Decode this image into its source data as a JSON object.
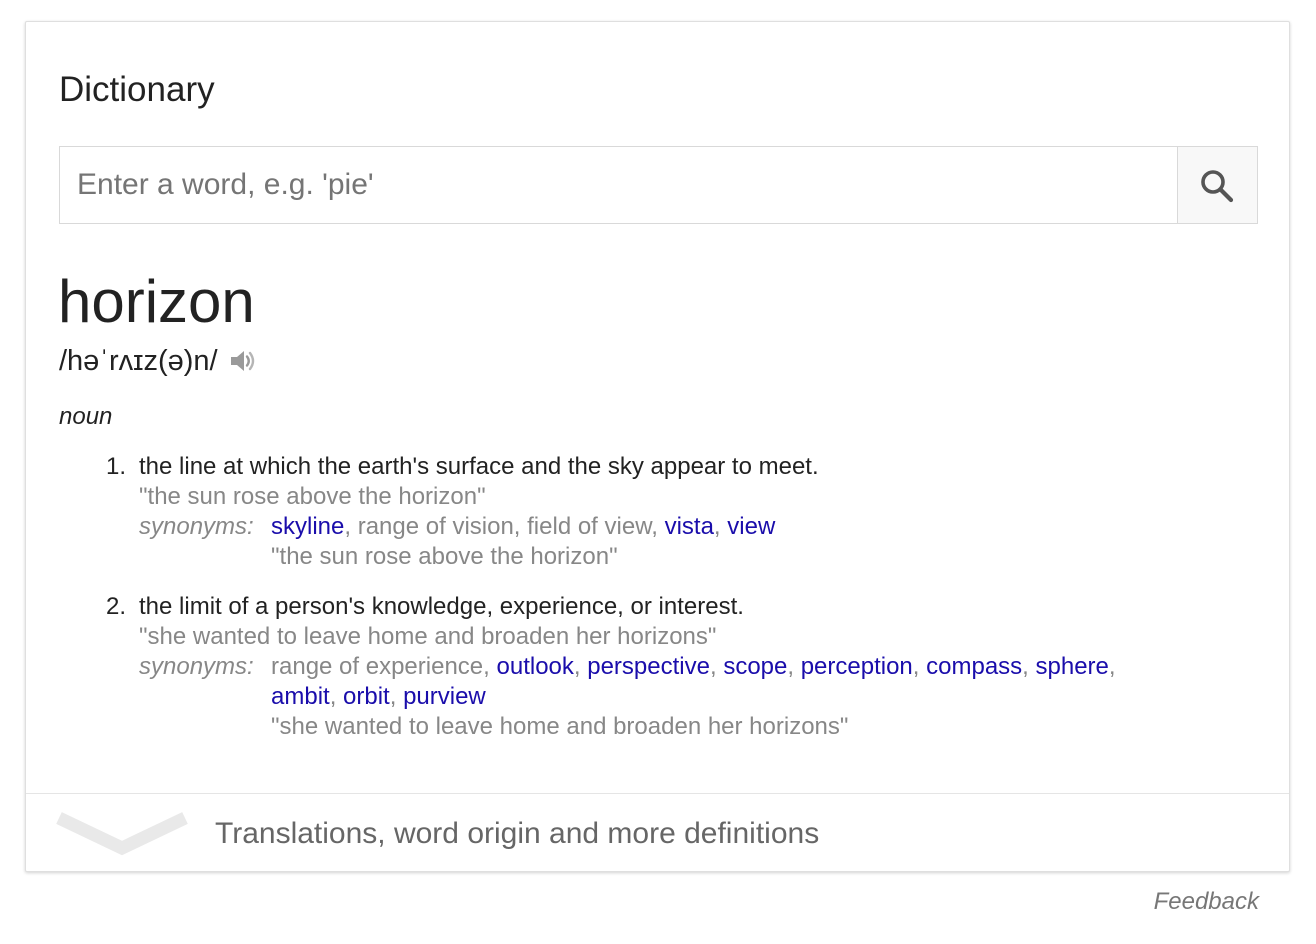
{
  "card": {
    "heading": "Dictionary",
    "search": {
      "placeholder": "Enter a word, e.g. 'pie'",
      "value": "",
      "button_icon": "search-icon"
    },
    "word": "horizon",
    "phonetic": "/həˈrʌɪz(ə)n/",
    "audio_icon": "speaker-icon",
    "part_of_speech": "noun",
    "definitions": [
      {
        "number": "1.",
        "text": "the line at which the earth's surface and the sky appear to meet.",
        "example": "\"the sun rose above the horizon\"",
        "synonyms_label": "synonyms:",
        "synonyms": [
          {
            "word": "skyline",
            "link": true
          },
          {
            "word": "range of vision",
            "link": false
          },
          {
            "word": "field of view",
            "link": false
          },
          {
            "word": "vista",
            "link": true
          },
          {
            "word": "view",
            "link": true
          }
        ],
        "synonym_example": "\"the sun rose above the horizon\""
      },
      {
        "number": "2.",
        "text": "the limit of a person's knowledge, experience, or interest.",
        "example": "\"she wanted to leave home and broaden her horizons\"",
        "synonyms_label": "synonyms:",
        "synonyms": [
          {
            "word": "range of experience",
            "link": false
          },
          {
            "word": "outlook",
            "link": true
          },
          {
            "word": "perspective",
            "link": true
          },
          {
            "word": "scope",
            "link": true
          },
          {
            "word": "perception",
            "link": true
          },
          {
            "word": "compass",
            "link": true
          },
          {
            "word": "sphere",
            "link": true
          },
          {
            "word": "ambit",
            "link": true
          },
          {
            "word": "orbit",
            "link": true
          },
          {
            "word": "purview",
            "link": true
          }
        ],
        "synonym_example": "\"she wanted to leave home and broaden her horizons\""
      }
    ],
    "more_link": "Translations, word origin and more definitions",
    "more_icon": "chevron-down-icon"
  },
  "feedback": "Feedback",
  "colors": {
    "link": "#1a0dab",
    "muted": "#878787",
    "text": "#222222"
  }
}
